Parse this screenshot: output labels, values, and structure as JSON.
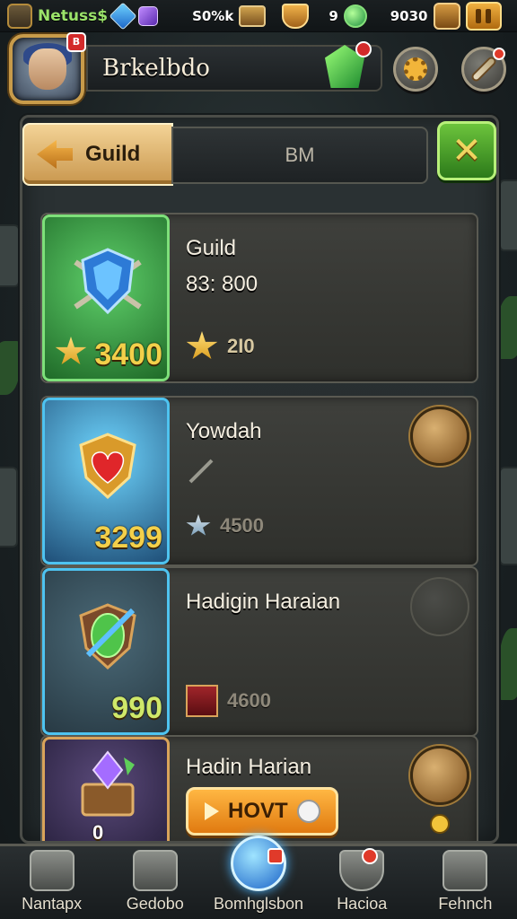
{
  "status_bar": {
    "player_tag": "Netuss$",
    "resource_1": "S0%k",
    "resource_2": "9",
    "resource_3": "9030"
  },
  "profile": {
    "avatar_badge": "B",
    "name": "Brkelbdo"
  },
  "tabs": {
    "active_label": "Guild",
    "inactive_label": "BM"
  },
  "close_label": "✕",
  "cards": [
    {
      "thumb_value": "3400",
      "title": "Guild",
      "subtitle": "83: 800",
      "stat": "2I0",
      "accent": "#2f9a3a"
    },
    {
      "thumb_value": "3299",
      "title": "Yowdah",
      "subtitle": "",
      "stat": "4500",
      "accent": "#35a7d8"
    },
    {
      "thumb_value": "990",
      "title": "Hadigin Haraian",
      "subtitle": "",
      "stat": "4600",
      "accent": "#35a7d8"
    },
    {
      "thumb_value": "0",
      "title": "Hadin Harian",
      "button_label": "HOVT",
      "accent": "#c9973e"
    }
  ],
  "bottom_nav": [
    {
      "label": "Nantapx",
      "icon": "home-icon"
    },
    {
      "label": "Gedobo",
      "icon": "anvil-icon"
    },
    {
      "label": "Bomhglsbon",
      "icon": "portal-icon"
    },
    {
      "label": "Hacioa",
      "icon": "shield-icon"
    },
    {
      "label": "Fehnch",
      "icon": "scroll-icon"
    }
  ]
}
